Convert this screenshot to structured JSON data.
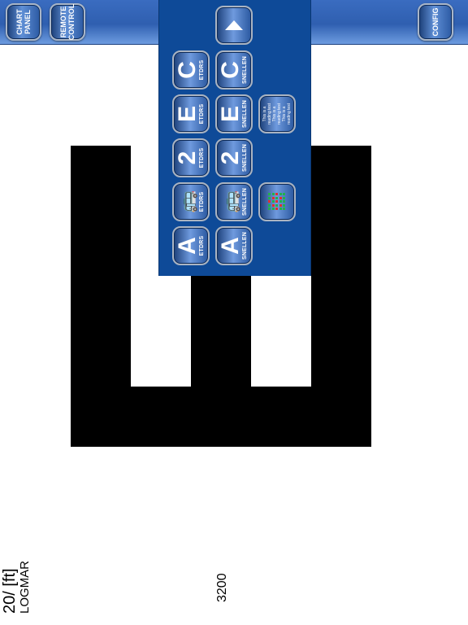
{
  "toolbar": {
    "chart_panel_label": "CHART\nPANEL",
    "remote_control_label": "REMOTE\nCONTROL",
    "config_label": "CONFIG"
  },
  "panel": {
    "up_icon": "up-arrow-icon",
    "rows": [
      {
        "glyph": "C",
        "etdrs": "ETDRS",
        "snellen": "SNELLEN"
      },
      {
        "glyph": "E",
        "etdrs": "ETDRS",
        "snellen": "SNELLEN",
        "reading": "This is a\nreading test\nThis is a\nreading test\nThis is a\nreading test"
      },
      {
        "glyph": "2",
        "etdrs": "ETDRS",
        "snellen": "SNELLEN"
      },
      {
        "glyph": "🚌",
        "etdrs": "ETDRS",
        "snellen": "SNELLEN"
      },
      {
        "glyph": "A",
        "etdrs": "ETDRS",
        "snellen": "SNELLEN"
      }
    ],
    "color_grid_icon": "color-dot-grid-icon"
  },
  "display": {
    "optotype": "E",
    "acuity_value": "3200",
    "acuity_unit": "20/ [ft]",
    "scale": "LOGMAR"
  },
  "colors": {
    "toolbar_blue": "#2f5fb0",
    "panel_blue": "#0e4a98",
    "grid_red": "#e03030",
    "grid_green": "#22b14c"
  }
}
